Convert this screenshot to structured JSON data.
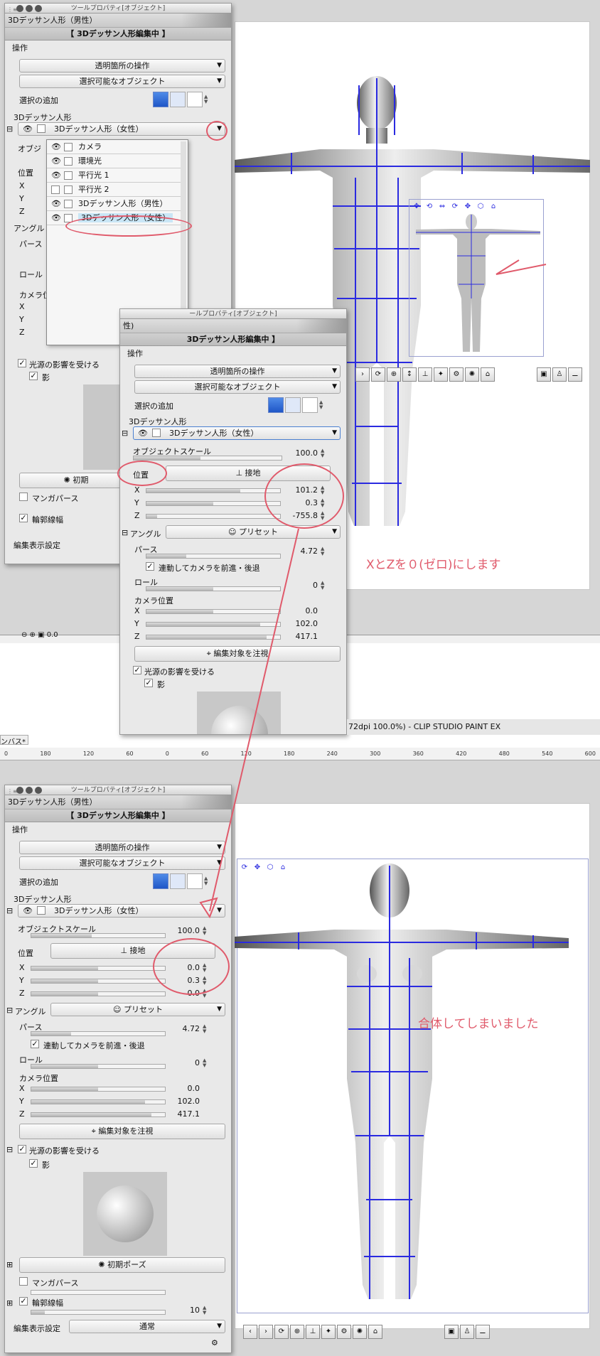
{
  "top": {
    "panel": {
      "window_title": "ツールプロパティ[オブジェクト]",
      "tool_name": "3Dデッサン人形（男性）",
      "editing_banner": "【 3Dデッサン人形編集中 】",
      "section_operation": "操作",
      "dd_transparent": "透明箇所の操作",
      "dd_selectable": "選択可能なオブジェクト",
      "select_add_label": "選択の追加",
      "section_doll": "3Dデッサン人形",
      "object_dd": "3Dデッサン人形（女性）",
      "hidden_obj_label": "オブジ",
      "hidden_pos_label": "位置",
      "hidden_angle": "アングル",
      "hidden_perse": "パース",
      "hidden_roll": "ロール",
      "hidden_camera": "カメラ位",
      "x": "X",
      "y": "Y",
      "z": "Z",
      "light_check": "光源の影響を受ける",
      "shadow_check": "影",
      "initial_pose": "初期",
      "manga_perse": "マンガパース",
      "outline": "輪郭線幅",
      "edit_display": "編集表示設定",
      "zoom_value": "0.0"
    },
    "dropdown_list": [
      {
        "label": "カメラ",
        "eye": true
      },
      {
        "label": "環境光",
        "eye": true
      },
      {
        "label": "平行光 1",
        "eye": true
      },
      {
        "label": "平行光 2",
        "eye": false
      },
      {
        "label": "3Dデッサン人形（男性）",
        "eye": true
      },
      {
        "label": "3Dデッサン人形（女性）",
        "eye": true
      }
    ],
    "annotation": "XとZを０(ゼロ)にします"
  },
  "middle": {
    "panel": {
      "window_title": "ールプロパティ[オブジェクト]",
      "tool_name": "性)",
      "editing_banner": "3Dデッサン人形編集中 】",
      "section_operation": "操作",
      "dd_transparent": "透明箇所の操作",
      "dd_selectable": "選択可能なオブジェクト",
      "select_add_label": "選択の追加",
      "section_doll": "3Dデッサン人形",
      "object_dd": "3Dデッサン人形（女性）",
      "object_scale": "オブジェクトスケール",
      "object_scale_value": "100.0",
      "position": "位置",
      "ground_btn": "接地",
      "x": "X",
      "y": "Y",
      "z": "Z",
      "pos_x": "101.2",
      "pos_y": "0.3",
      "pos_z": "-755.8",
      "angle": "アングル",
      "preset_btn": "プリセット",
      "perse": "パース",
      "perse_value": "4.72",
      "dolly": "連動してカメラを前進・後退",
      "roll": "ロール",
      "roll_value": "0",
      "camera_pos": "カメラ位置",
      "cam_x": "0.0",
      "cam_y": "102.0",
      "cam_z": "417.1",
      "focus_btn": "編集対象を注視",
      "light_check": "光源の影響を受ける",
      "shadow_check": "影"
    },
    "app_title": "72dpi 100.0%)  - CLIP STUDIO PAINT EX",
    "tab_label": "ンバス*",
    "ruler_ticks": [
      "0",
      "180",
      "120",
      "60",
      "0",
      "60",
      "120",
      "180",
      "240",
      "300",
      "360",
      "420",
      "480",
      "540",
      "600"
    ]
  },
  "bottom": {
    "panel": {
      "window_title": "ツールプロパティ[オブジェクト]",
      "tool_name": "3Dデッサン人形（男性）",
      "editing_banner": "【 3Dデッサン人形編集中 】",
      "section_operation": "操作",
      "dd_transparent": "透明箇所の操作",
      "dd_selectable": "選択可能なオブジェクト",
      "select_add_label": "選択の追加",
      "section_doll": "3Dデッサン人形",
      "object_dd": "3Dデッサン人形（女性）",
      "object_scale": "オブジェクトスケール",
      "object_scale_value": "100.0",
      "position": "位置",
      "ground_btn": "接地",
      "x": "X",
      "y": "Y",
      "z": "Z",
      "pos_x": "0.0",
      "pos_y": "0.3",
      "pos_z": "0.0",
      "angle": "アングル",
      "preset_btn": "プリセット",
      "perse": "パース",
      "perse_value": "4.72",
      "dolly": "連動してカメラを前進・後退",
      "roll": "ロール",
      "roll_value": "0",
      "camera_pos": "カメラ位置",
      "cam_x": "0.0",
      "cam_y": "102.0",
      "cam_z": "417.1",
      "focus_btn": "編集対象を注視",
      "light_check": "光源の影響を受ける",
      "shadow_check": "影",
      "initial_pose": "初期ポーズ",
      "manga_perse": "マンガパース",
      "outline": "輪郭線幅",
      "outline_value": "10",
      "edit_display": "編集表示設定",
      "edit_display_value": "通常"
    },
    "annotation": "合体してしまいました"
  },
  "colors": {
    "annotation": "#e05a6b",
    "wire": "#2a2ae0",
    "panel_bg": "#e9e9e9"
  }
}
